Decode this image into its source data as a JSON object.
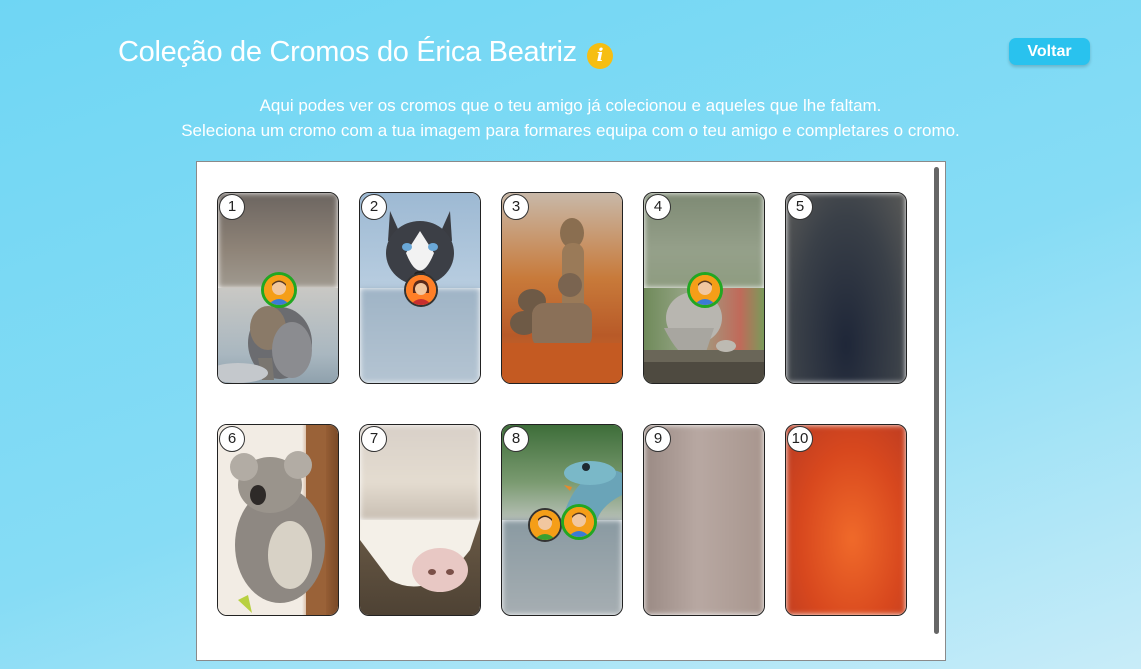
{
  "header": {
    "title": "Coleção de Cromos do Érica Beatriz",
    "back_label": "Voltar",
    "info_icon": "info-icon"
  },
  "description": {
    "line1": "Aqui podes ver os cromos que o teu amigo já colecionou e aqueles que lhe faltam.",
    "line2": "Seleciona um cromo com a tua imagem para formares equipa com o teu amigo e completares o cromo."
  },
  "cards": [
    {
      "number": "1",
      "state": "half-collected",
      "subject": "cat"
    },
    {
      "number": "2",
      "state": "half-collected",
      "subject": "husky"
    },
    {
      "number": "3",
      "state": "collected",
      "subject": "meerkats"
    },
    {
      "number": "4",
      "state": "half-collected",
      "subject": "monkey"
    },
    {
      "number": "5",
      "state": "missing",
      "subject": "unknown"
    },
    {
      "number": "6",
      "state": "collected",
      "subject": "koala"
    },
    {
      "number": "7",
      "state": "half-collected",
      "subject": "sheep"
    },
    {
      "number": "8",
      "state": "half-collected",
      "subject": "lizard"
    },
    {
      "number": "9",
      "state": "missing",
      "subject": "unknown"
    },
    {
      "number": "10",
      "state": "missing",
      "subject": "unknown"
    }
  ],
  "colors": {
    "background": "#6fd6f4",
    "button": "#29c2ee",
    "info": "#f6be12",
    "avatar_ring_green": "#22a722",
    "avatar_ring_red": "#cc2222"
  }
}
